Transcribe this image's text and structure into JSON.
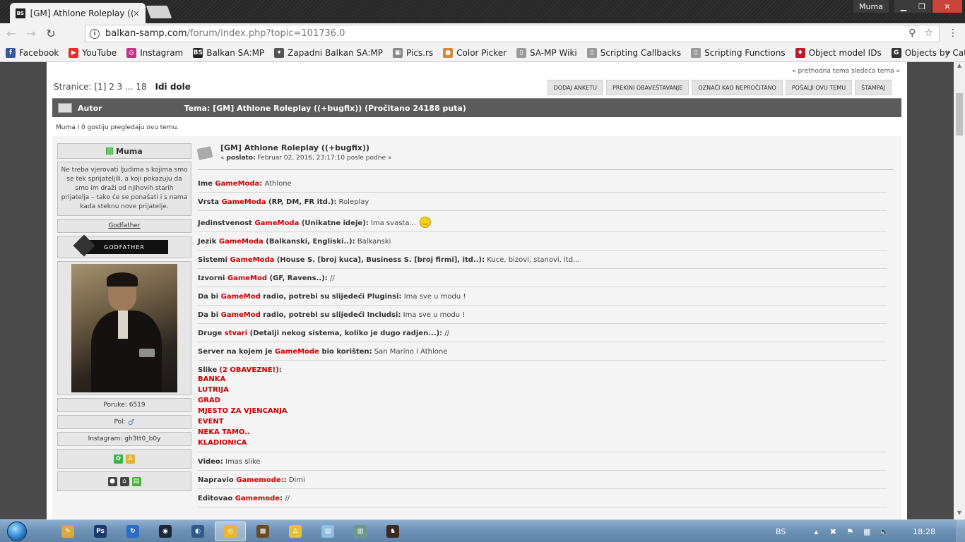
{
  "browser": {
    "tab_title": "[GM] Athlone Roleplay ((+",
    "tab_close": "×",
    "favicon": "BS",
    "user": "Muma",
    "url_host": "balkan-samp.com",
    "url_path": "/forum/index.php?topic=101736.0",
    "bookmarks": [
      {
        "label": "Facebook",
        "icon": "facebook-icon",
        "color": "#3b5998",
        "glyph": "f"
      },
      {
        "label": "YouTube",
        "icon": "youtube-icon",
        "color": "#e52d27",
        "glyph": "▶"
      },
      {
        "label": "Instagram",
        "icon": "instagram-icon",
        "color": "#c13584",
        "glyph": "◎"
      },
      {
        "label": "Balkan SA:MP",
        "icon": "balkan-samp-icon",
        "color": "#222222",
        "glyph": "BS"
      },
      {
        "label": "Zapadni Balkan SA:MP",
        "icon": "zapadni-balkan-icon",
        "color": "#555555",
        "glyph": "✦"
      },
      {
        "label": "Pics.rs",
        "icon": "pics-icon",
        "color": "#888888",
        "glyph": "▣"
      },
      {
        "label": "Color Picker",
        "icon": "palette-icon",
        "color": "#d08a3a",
        "glyph": "●"
      },
      {
        "label": "SA-MP Wiki",
        "icon": "page-icon",
        "color": "#9a9a9a",
        "glyph": "▯"
      },
      {
        "label": "Scripting Callbacks",
        "icon": "page-icon",
        "color": "#9a9a9a",
        "glyph": "▯"
      },
      {
        "label": "Scripting Functions",
        "icon": "page-icon",
        "color": "#9a9a9a",
        "glyph": "▯"
      },
      {
        "label": "Object model IDs",
        "icon": "shield-icon",
        "color": "#b3202a",
        "glyph": "♦"
      },
      {
        "label": "Objects by Category",
        "icon": "objects-icon",
        "color": "#333333",
        "glyph": "G"
      }
    ],
    "bookmarks_more": "»"
  },
  "forum": {
    "prevnext": "« prethodna tema sledeća tema »",
    "pages_label": "Stranice:",
    "pages": "[1] 2 3 ... 18",
    "go_down": "Idi dole",
    "actions": [
      "DODAJ ANKETU",
      "PREKINI OBAVEŠTAVANJE",
      "OZNAČI KAO NEPROČITANO",
      "POŠALJI OVU TEMU",
      "ŠTAMPAJ"
    ],
    "header_author": "Autor",
    "header_topic": "Tema: [GM] Athlone Roleplay ((+bugfix))  (Pročitano 24188 puta)",
    "viewers": "Muma i 0 gostiju pregledaju ovu temu."
  },
  "poster": {
    "name": "Muma",
    "quote": "Ne treba vjerovati ljudima s kojima smo se tek sprijateljili, a koji pokazuju da smo im draži od njihovih starih prijatelja – tako će se ponašati i s nama kada steknu nove prijatelje.",
    "rank": "Godfather",
    "badge": "GODFATHER",
    "posts": "Poruke: 6519",
    "gender": "Pol:",
    "gender_symbol": "♂",
    "instagram": "Instagram: gh3tt0_b0y"
  },
  "post": {
    "title": "[GM] Athlone Roleplay ((+bugfix))",
    "date_prefix": "«",
    "date_label": "poslato:",
    "date": "Februar 02, 2016, 23:17:10 posle podne »",
    "lines": {
      "l1": {
        "a": "Ime ",
        "b": "GameModa",
        "c": ":",
        "v": " Athlone"
      },
      "l2": {
        "a": "Vrsta ",
        "b": "GameModa",
        "c": " (RP, DM, FR itd.):",
        "v": " Roleplay"
      },
      "l3": {
        "a": "Jedinstvenost ",
        "b": "GameModa",
        "c": " (Unikatne ideje):",
        "v": " Ima svasta... "
      },
      "l4": {
        "a": "Jezik ",
        "b": "GameModa",
        "c": " (Balkanski, Engliski..):",
        "v": " Balkanski"
      },
      "l5": {
        "a": "Sistemi ",
        "b": "GameModa",
        "c": " (House S. [broj kuca], Business S. [broj firmi], itd..):",
        "v": " Kuce, bizovi, stanovi, itd..."
      },
      "l6": {
        "a": "Izvorni ",
        "b": "GameMod",
        "c": " (GF, Ravens..):",
        "v": " //"
      },
      "l7": {
        "a": "Da bi ",
        "b": "GameMod",
        "c": " radio, potrebi su slijedeći Pluginsi:",
        "v": " Ima sve u modu !"
      },
      "l8": {
        "a": "Da bi ",
        "b": "GameMod",
        "c": " radio, potrebi su slijedeći Includsi:",
        "v": " Ima sve u modu !"
      },
      "l9": {
        "a": "Druge ",
        "b": "stvari",
        "c": " (Detalji nekog sistema, koliko je dugo radjen...):",
        "v": " //"
      },
      "l10": {
        "a": "Server na kojem je ",
        "b": "GameMode",
        "c": " bio korišten:",
        "v": " San Marino i Athlone"
      },
      "l12": {
        "a": "Video:",
        "v": " Imas slike"
      },
      "l13": {
        "a": "Napravio ",
        "b": "Gamemode:",
        "c": ":",
        "v": " Dimi"
      },
      "l14": {
        "a": "Editovao ",
        "b": "Gamemode",
        "c": ":",
        "v": " //"
      }
    },
    "slike_label": "Slike",
    "slike_note": "(2 OBAVEZNE!)",
    "slike_colon": ":",
    "slike": [
      "BANKA",
      "LUTRIJA",
      "GRAD",
      "MJESTO ZA VJENCANJA",
      "EVENT",
      "NEKA TAMO..",
      "KLADIONICA"
    ]
  },
  "taskbar": {
    "lang": "BS",
    "time": "18:28",
    "items": [
      {
        "name": "taskbar-item-explorer",
        "color": "#d8a93c",
        "glyph": "✎"
      },
      {
        "name": "taskbar-item-photoshop",
        "color": "#1b3b6e",
        "glyph": "Ps"
      },
      {
        "name": "taskbar-item-teamviewer",
        "color": "#2b6cc4",
        "glyph": "↻"
      },
      {
        "name": "taskbar-item-steam",
        "color": "#1b2838",
        "glyph": "◉"
      },
      {
        "name": "taskbar-item-teamspeak",
        "color": "#2f5a8a",
        "glyph": "◐"
      },
      {
        "name": "taskbar-item-chrome",
        "color": "#e8b534",
        "glyph": "◎"
      },
      {
        "name": "taskbar-item-samp",
        "color": "#6a4a2a",
        "glyph": "▩"
      },
      {
        "name": "taskbar-item-icq",
        "color": "#e3c23a",
        "glyph": "♙"
      },
      {
        "name": "taskbar-item-notepad",
        "color": "#8fc0e0",
        "glyph": "▤"
      },
      {
        "name": "taskbar-item-window",
        "color": "#6f9a8a",
        "glyph": "▥"
      },
      {
        "name": "taskbar-item-game",
        "color": "#3a2a1f",
        "glyph": "♞"
      }
    ]
  }
}
